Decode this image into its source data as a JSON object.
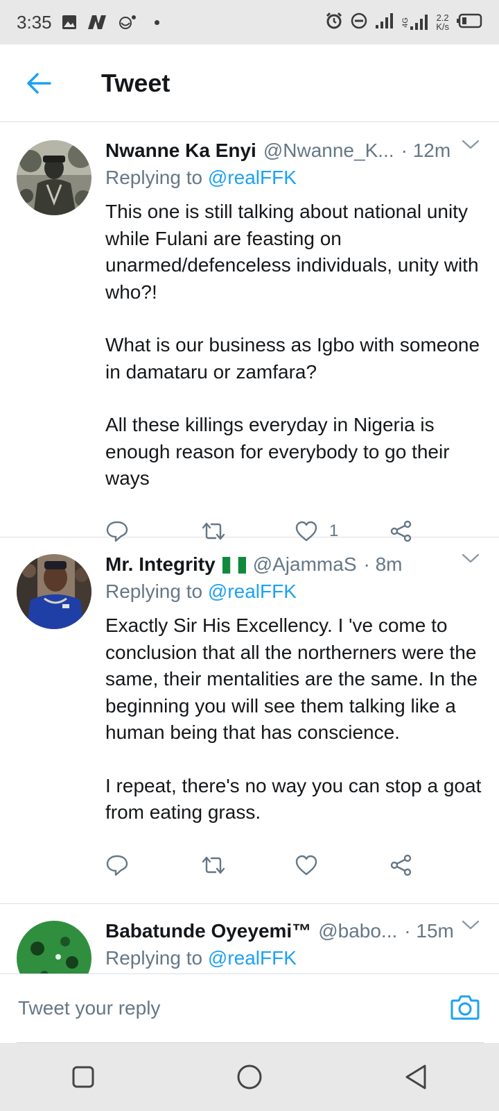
{
  "status_bar": {
    "time": "3:35",
    "network": "4G",
    "speed_value": "2.2",
    "speed_unit": "K/s"
  },
  "header": {
    "title": "Tweet"
  },
  "tweets": [
    {
      "name": "Nwanne Ka Enyi",
      "handle": "@Nwanne_K...",
      "time": "· 12m",
      "replying_prefix": "Replying to",
      "replying_to": "@realFFK",
      "paragraphs": [
        "This one is still talking about national unity while Fulani are feasting on unarmed/defenceless individuals, unity with who?!",
        "What is our business as Igbo with someone in damataru or zamfara?",
        "All these killings everyday in Nigeria is enough reason for everybody to go their ways"
      ],
      "like_count": "1"
    },
    {
      "name": "Mr. Integrity",
      "handle": "@AjammaS",
      "time": "· 8m",
      "replying_prefix": "Replying to",
      "replying_to": "@realFFK",
      "paragraphs": [
        "Exactly Sir His Excellency. I 've come to conclusion that all the northerners were the same, their mentalities are the same. In the beginning you will see them talking like a human being that has conscience.",
        "I repeat, there's no way you can stop a goat from eating grass."
      ],
      "like_count": ""
    },
    {
      "name": "Babatunde Oyeyemi™",
      "handle": "@babo...",
      "time": "· 15m",
      "replying_prefix": "Replying to",
      "replying_to": "@realFFK"
    }
  ],
  "reply_bar": {
    "placeholder": "Tweet your reply"
  },
  "colors": {
    "accent": "#1da1f2",
    "secondary_text": "#657786",
    "divider": "#d9dfe3"
  }
}
